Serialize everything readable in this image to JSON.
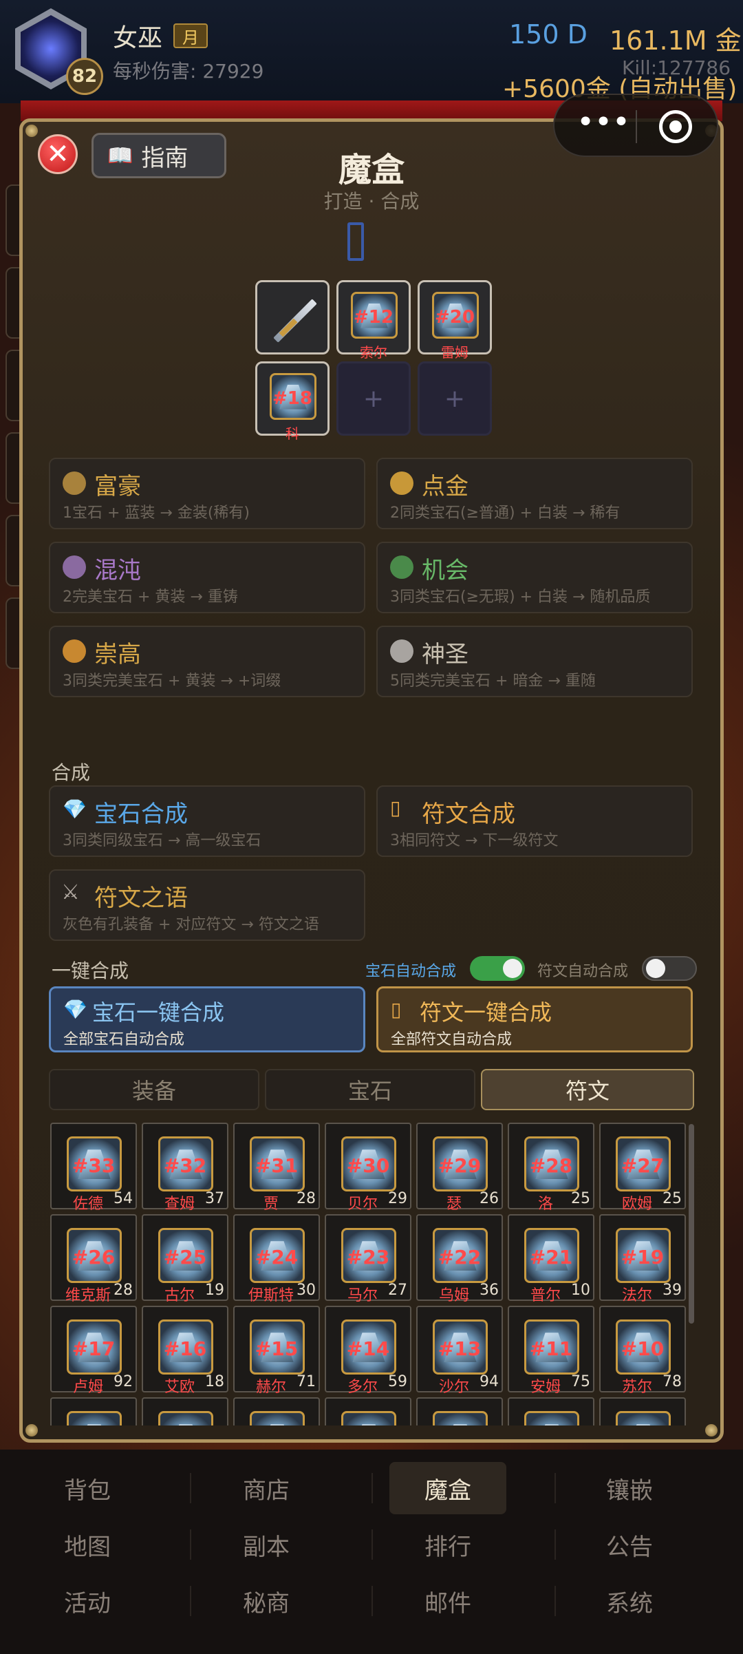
{
  "header": {
    "player_name": "女巫",
    "month_badge": "月",
    "level": "82",
    "dps": "每秒伤害: 27929",
    "diamonds": "150 D",
    "gold": "161.1M 金",
    "gold_income": "+5600金 (自动出售)",
    "kills": "Kill:127786",
    "capsule_dots": "•••"
  },
  "modal": {
    "close_label": "✕",
    "guide_label": "指南",
    "title": "魔盒",
    "subtitle": "打造 · 合成",
    "slots": [
      {
        "type": "sword"
      },
      {
        "type": "rune",
        "num": "#12",
        "name": "索尔"
      },
      {
        "type": "rune",
        "num": "#20",
        "name": "雷姆"
      },
      {
        "type": "rune",
        "num": "#18",
        "name": "科"
      },
      {
        "type": "empty",
        "plus": "+"
      },
      {
        "type": "empty",
        "plus": "+"
      }
    ],
    "recipes": [
      {
        "name": "富豪",
        "desc": "1宝石 + 蓝装 → 金装(稀有)",
        "color": "#d8a848",
        "icon_color": "#a8823c"
      },
      {
        "name": "点金",
        "desc": "2同类宝石(≥普通) + 白装 → 稀有",
        "color": "#d8a848",
        "icon_color": "#c89838"
      },
      {
        "name": "混沌",
        "desc": "2完美宝石 + 黄装 → 重铸",
        "color": "#a878c8",
        "icon_color": "#8a6aa0"
      },
      {
        "name": "机会",
        "desc": "3同类宝石(≥无瑕) + 白装 → 随机品质",
        "color": "#68b868",
        "icon_color": "#4a8a4a"
      },
      {
        "name": "崇高",
        "desc": "3同类完美宝石 + 黄装 → +词缀",
        "color": "#d8a848",
        "icon_color": "#c88830"
      },
      {
        "name": "神圣",
        "desc": "5同类完美宝石 + 暗金 → 重随",
        "color": "#c8c0b0",
        "icon_color": "#a8a4a0"
      }
    ],
    "synth_label": "合成",
    "synth_recipes": [
      {
        "name": "宝石合成",
        "desc": "3同类同级宝石 → 高一级宝石",
        "color": "#5aa8e8",
        "icon": "💎"
      },
      {
        "name": "符文合成",
        "desc": "3相同符文 → 下一级符文",
        "color": "#e8a848",
        "icon": "▯"
      },
      {
        "name": "符文之语",
        "desc": "灰色有孔装备 + 对应符文 → 符文之语",
        "color": "#d8a848",
        "icon": "⚔"
      }
    ],
    "oneclick_label": "一键合成",
    "gem_auto_label": "宝石自动合成",
    "rune_auto_label": "符文自动合成",
    "gem_btn_title": "宝石一键合成",
    "gem_btn_sub": "全部宝石自动合成",
    "rune_btn_title": "符文一键合成",
    "rune_btn_sub": "全部符文自动合成",
    "tabs": [
      "装备",
      "宝石",
      "符文"
    ],
    "runes": [
      {
        "num": "#33",
        "name": "佐德",
        "count": "54"
      },
      {
        "num": "#32",
        "name": "查姆",
        "count": "37"
      },
      {
        "num": "#31",
        "name": "贾",
        "count": "28"
      },
      {
        "num": "#30",
        "name": "贝尔",
        "count": "29"
      },
      {
        "num": "#29",
        "name": "瑟",
        "count": "26"
      },
      {
        "num": "#28",
        "name": "洛",
        "count": "25"
      },
      {
        "num": "#27",
        "name": "欧姆",
        "count": "25"
      },
      {
        "num": "#26",
        "name": "维克斯",
        "count": "28"
      },
      {
        "num": "#25",
        "name": "古尔",
        "count": "19"
      },
      {
        "num": "#24",
        "name": "伊斯特",
        "count": "30"
      },
      {
        "num": "#23",
        "name": "马尔",
        "count": "27"
      },
      {
        "num": "#22",
        "name": "乌姆",
        "count": "36"
      },
      {
        "num": "#21",
        "name": "普尔",
        "count": "10"
      },
      {
        "num": "#19",
        "name": "法尔",
        "count": "39"
      },
      {
        "num": "#17",
        "name": "卢姆",
        "count": "92"
      },
      {
        "num": "#16",
        "name": "艾欧",
        "count": "18"
      },
      {
        "num": "#15",
        "name": "赫尔",
        "count": "71"
      },
      {
        "num": "#14",
        "name": "多尔",
        "count": "59"
      },
      {
        "num": "#13",
        "name": "沙尔",
        "count": "94"
      },
      {
        "num": "#11",
        "name": "安姆",
        "count": "75"
      },
      {
        "num": "#10",
        "name": "苏尔",
        "count": "78"
      }
    ]
  },
  "bottom_nav": [
    [
      "背包",
      "商店",
      "魔盒",
      "镶嵌"
    ],
    [
      "地图",
      "副本",
      "排行",
      "公告"
    ],
    [
      "活动",
      "秘商",
      "邮件",
      "系统"
    ]
  ],
  "colors": {
    "accent_gold": "#b09460",
    "rune_number": "#ff4a4a",
    "toggle_on": "#3aa048",
    "gem_blue": "#5aa8e8"
  }
}
